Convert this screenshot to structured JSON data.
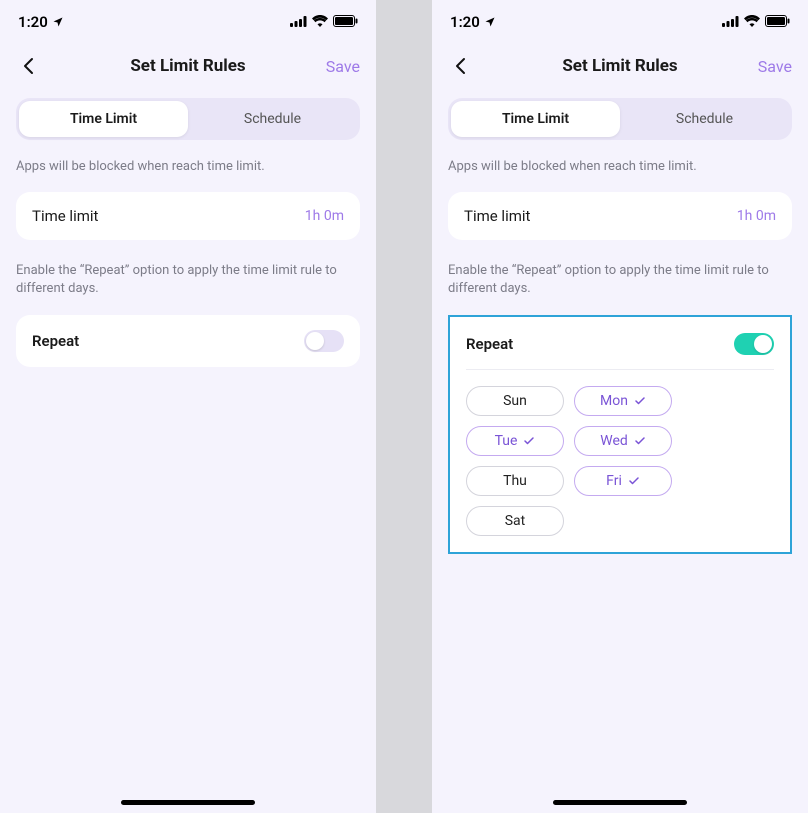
{
  "status": {
    "time": "1:20",
    "location_icon": "location-arrow",
    "signal_icon": "cellular",
    "wifi_icon": "wifi",
    "battery_icon": "battery-full"
  },
  "nav": {
    "title": "Set Limit Rules",
    "save": "Save"
  },
  "tabs": {
    "time_limit": "Time Limit",
    "schedule": "Schedule"
  },
  "hints": {
    "blocked": "Apps will be blocked when reach time limit.",
    "repeat": "Enable the “Repeat” option to apply the time limit rule to different days."
  },
  "time_limit_row": {
    "label": "Time limit",
    "value": "1h 0m"
  },
  "repeat": {
    "label": "Repeat"
  },
  "days": [
    {
      "label": "Sun",
      "selected": false
    },
    {
      "label": "Mon",
      "selected": true
    },
    {
      "label": "Tue",
      "selected": true
    },
    {
      "label": "Wed",
      "selected": true
    },
    {
      "label": "Thu",
      "selected": false
    },
    {
      "label": "Fri",
      "selected": true
    },
    {
      "label": "Sat",
      "selected": false
    }
  ],
  "screens": {
    "left": {
      "repeat_on": false,
      "show_days": false,
      "highlight_repeat": false
    },
    "right": {
      "repeat_on": true,
      "show_days": true,
      "highlight_repeat": true
    }
  },
  "colors": {
    "accent_purple": "#9e7ae8",
    "accent_teal": "#1fd1b2",
    "highlight_border": "#2ea3d8",
    "bg": "#f5f3fd"
  }
}
